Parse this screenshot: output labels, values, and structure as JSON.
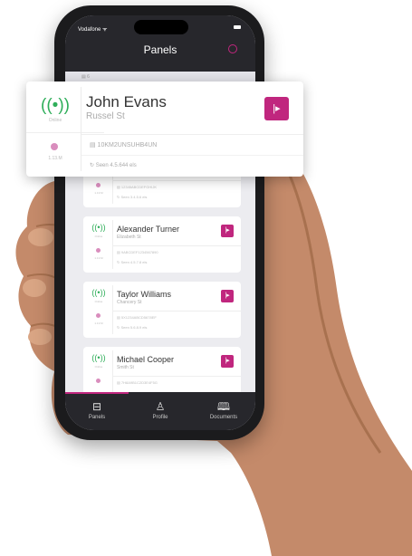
{
  "status": {
    "carrier": "Vodafone ᯤ"
  },
  "header": {
    "title": "Panels",
    "accent_color": "#c0267e"
  },
  "subheader": {
    "text": "▤ 6"
  },
  "featured": {
    "name": "John Evans",
    "street": "Russel St",
    "serial": "▤ 10KM2UNSUHB4UN",
    "last_seen": "↻ Seen 4.5.644 els",
    "signal_glyph": "((•))",
    "signal_label": "Online",
    "time_label": "1.13.M",
    "button_glyph": "|▸"
  },
  "cards": [
    {
      "name": "",
      "street": "",
      "serial": "▤ 12345ABCDEFGHIJK",
      "last_seen": "↻ Seen 3.4.5.6 els"
    },
    {
      "name": "Alexander Turner",
      "street": "Elizabeth St",
      "serial": "▤ 9ABCDEF1234567890",
      "last_seen": "↻ Seen 4.5.7.8 els"
    },
    {
      "name": "Taylor Williams",
      "street": "Chancery St",
      "serial": "▤ 5X1234ABCD5678EF",
      "last_seen": "↻ Seen 5.6.8.9 els"
    },
    {
      "name": "Michael Cooper",
      "street": "Smith St",
      "serial": "▤ 7H8A9B1C2D3E4F5G",
      "last_seen": ""
    }
  ],
  "card_common": {
    "signal_glyph": "((•))",
    "signal_label": "Online",
    "time_label": "1.13.M",
    "button_glyph": "|▸"
  },
  "tabs": [
    {
      "label": "Panels",
      "icon_glyph": "⊟"
    },
    {
      "label": "Profile",
      "icon_glyph": "♙"
    },
    {
      "label": "Documents",
      "icon_glyph": "🕮"
    }
  ]
}
